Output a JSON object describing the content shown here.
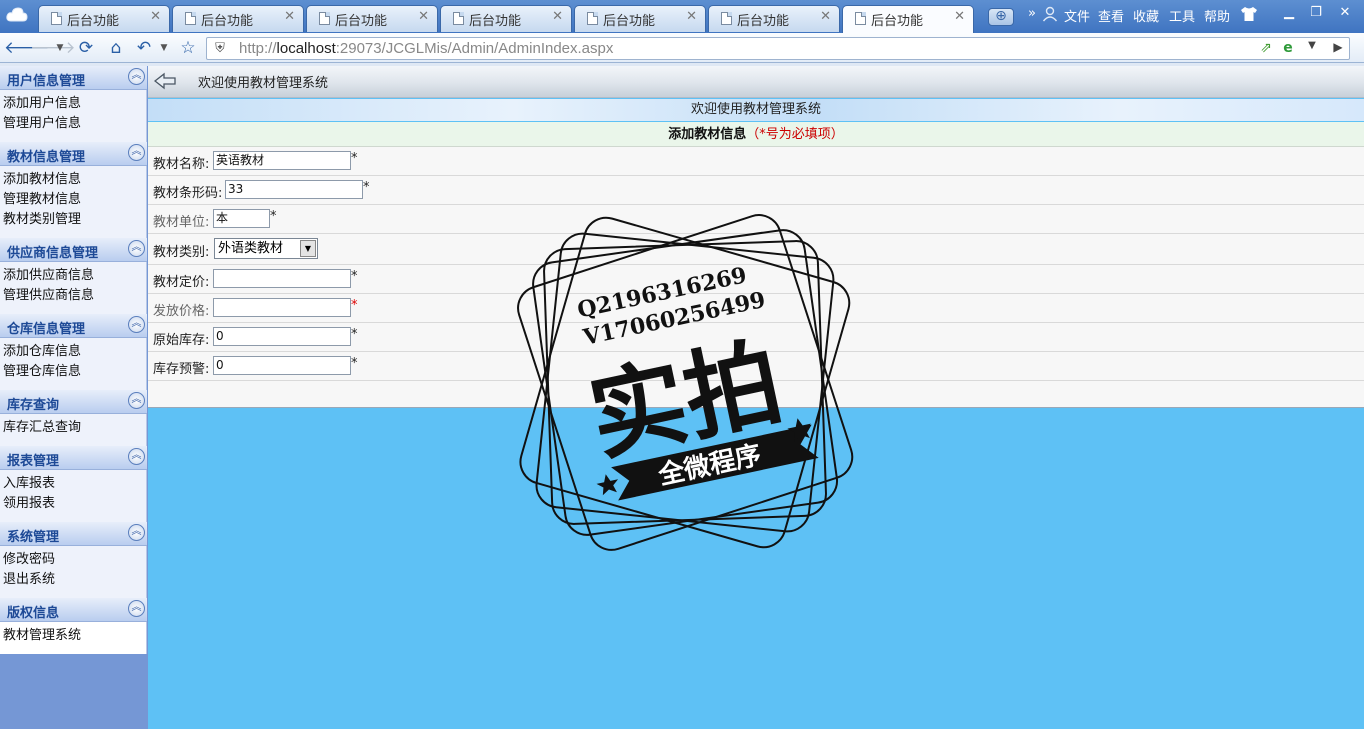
{
  "browser": {
    "tabs": [
      {
        "label": "后台功能",
        "active": false
      },
      {
        "label": "后台功能",
        "active": false
      },
      {
        "label": "后台功能",
        "active": false
      },
      {
        "label": "后台功能",
        "active": false
      },
      {
        "label": "后台功能",
        "active": false
      },
      {
        "label": "后台功能",
        "active": false
      },
      {
        "label": "后台功能",
        "active": true
      }
    ],
    "new_tab_icon": "plus-icon",
    "menu": {
      "more": "»",
      "file": "文件",
      "view": "查看",
      "favorites": "收藏",
      "tools": "工具",
      "help": "帮助"
    },
    "address": {
      "url_prefix": "http://",
      "url_host": "localhost",
      "url_rest": ":29073/JCGLMis/Admin/AdminIndex.aspx"
    }
  },
  "sidebar": {
    "groups": [
      {
        "title": "用户信息管理",
        "items": [
          "添加用户信息",
          "管理用户信息"
        ]
      },
      {
        "title": "教材信息管理",
        "items": [
          "添加教材信息",
          "管理教材信息",
          "教材类别管理"
        ]
      },
      {
        "title": "供应商信息管理",
        "items": [
          "添加供应商信息",
          "管理供应商信息"
        ]
      },
      {
        "title": "仓库信息管理",
        "items": [
          "添加仓库信息",
          "管理仓库信息"
        ]
      },
      {
        "title": "库存查询",
        "items": [
          "库存汇总查询"
        ]
      },
      {
        "title": "报表管理",
        "items": [
          "入库报表",
          "领用报表"
        ]
      },
      {
        "title": "系统管理",
        "items": [
          "修改密码",
          "退出系统"
        ]
      },
      {
        "title": "版权信息",
        "items": [
          "教材管理系统"
        ]
      }
    ]
  },
  "main": {
    "header_text": "欢迎使用教材管理系统",
    "banner_text": "欢迎使用教材管理系统",
    "form": {
      "title": "添加教材信息",
      "required_note": "（*号为必填项）",
      "fields": [
        {
          "label": "教材名称:",
          "value": "英语教材",
          "star": "*"
        },
        {
          "label": "教材条形码:",
          "value": "33",
          "star": "*"
        },
        {
          "label": "教材单位:",
          "value": "本",
          "star": "*"
        },
        {
          "label": "教材类别:",
          "value": "外语类教材",
          "star": ""
        },
        {
          "label": "教材定价:",
          "value": "",
          "star": "*"
        },
        {
          "label": "发放价格:",
          "value": "",
          "star": "*"
        },
        {
          "label": "原始库存:",
          "value": "0",
          "star": "*"
        },
        {
          "label": "库存预警:",
          "value": "0",
          "star": "*"
        }
      ]
    }
  },
  "watermark": {
    "line1": "Q2196316269",
    "line2": "V17060256499",
    "big": "实拍",
    "ribbon": "全微程序"
  }
}
